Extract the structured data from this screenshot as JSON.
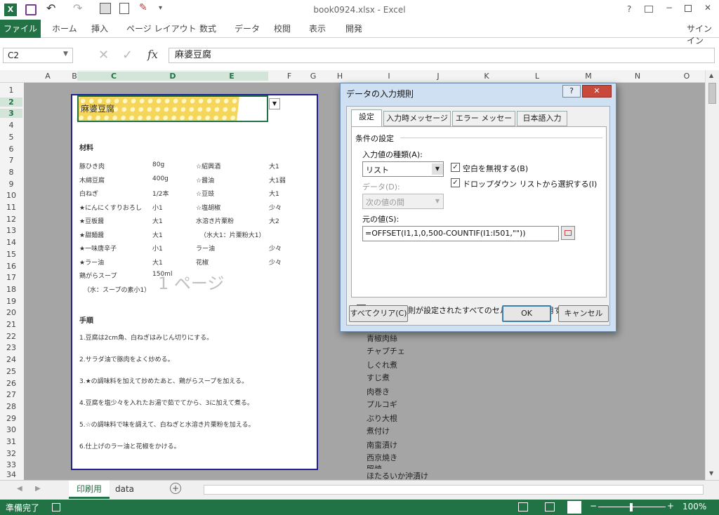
{
  "titlebar": {
    "title": "book0924.xlsx - Excel",
    "help": "?",
    "signin": "サインイン"
  },
  "ribbon": {
    "file": "ファイル",
    "tabs": [
      "ホーム",
      "挿入",
      "ページ レイアウト",
      "数式",
      "データ",
      "校閲",
      "表示",
      "開発"
    ]
  },
  "formula": {
    "namebox": "C2",
    "value": "麻婆豆腐",
    "fx": "fx"
  },
  "columns": [
    "A",
    "B",
    "C",
    "D",
    "E",
    "F",
    "G",
    "H",
    "I",
    "J",
    "K",
    "L",
    "M",
    "N",
    "O"
  ],
  "rows": [
    "1",
    "2",
    "3",
    "4",
    "5",
    "6",
    "7",
    "8",
    "9",
    "10",
    "11",
    "12",
    "13",
    "14",
    "15",
    "16",
    "17",
    "18",
    "19",
    "20",
    "21",
    "22",
    "23",
    "24",
    "25",
    "26",
    "27",
    "28",
    "29",
    "30",
    "31",
    "32",
    "33",
    "34"
  ],
  "page": {
    "title": "麻婆豆腐",
    "watermark": "1 ページ",
    "materials_heading": "材料",
    "ingredients": [
      [
        "豚ひき肉",
        "80g",
        "☆紹興酒",
        "大1"
      ],
      [
        "木綿豆腐",
        "400g",
        "☆醤油",
        "大1弱"
      ],
      [
        "白ねぎ",
        "1/2本",
        "☆豆豉",
        "大1"
      ],
      [
        "★にんにくすりおろし",
        "小1",
        "☆塩胡椒",
        "少々"
      ],
      [
        "★豆板醤",
        "大1",
        "水溶き片栗粉",
        "大2"
      ],
      [
        "★甜麺醤",
        "大1",
        "（水大1：片栗粉大1）",
        ""
      ],
      [
        "★一味唐辛子",
        "小1",
        "ラー油",
        "少々"
      ],
      [
        "★ラー油",
        "大1",
        "花椒",
        "少々"
      ],
      [
        "鶏がらスープ",
        "150ml",
        "",
        ""
      ],
      [
        "（水：スープの素小1）",
        "",
        "",
        ""
      ]
    ],
    "steps_heading": "手順",
    "steps": [
      "1.豆腐は2cm角、白ねぎはみじん切りにする。",
      "2.サラダ油で豚肉をよく炒める。",
      "3.★の調味料を加えて炒めたあと、鶏がらスープを加える。",
      "4.豆腐を塩少々を入れたお湯で茹でてから、3に加えて煮る。",
      "5.☆の調味料で味を調えて、白ねぎと水溶き片栗粉を加える。",
      "6.仕上げのラー油と花椒をかける。"
    ]
  },
  "list_items": [
    "青椒肉絲",
    "チャプチェ",
    "しぐれ煮",
    "すじ煮",
    "肉巻き",
    "プルコギ",
    "ぶり大根",
    "煮付け",
    "南蛮漬け",
    "西京焼き",
    "照焼",
    "ほたるいか沖漬け"
  ],
  "dialog": {
    "title": "データの入力規則",
    "tabs": [
      "設定",
      "入力時メッセージ",
      "エラー メッセージ",
      "日本語入力"
    ],
    "section": "条件の設定",
    "type_label": "入力値の種類(A):",
    "type_value": "リスト",
    "ignore_blank": "空白を無視する(B)",
    "dropdown": "ドロップダウン リストから選択する(I)",
    "data_label": "データ(D):",
    "data_value": "次の値の間",
    "source_label": "元の値(S):",
    "source_value": "=OFFSET(I1,1,0,500-COUNTIF(I1:I501,\"\"))",
    "apply_all": "同じ入力規則が設定されたすべてのセルに変更を適用する(P)",
    "clear_all": "すべてクリア(C)",
    "ok": "OK",
    "cancel": "キャンセル"
  },
  "sheets": [
    "印刷用",
    "data"
  ],
  "status": {
    "ready": "準備完了",
    "zoom": "100%"
  },
  "colors": {
    "excel_green": "#217346",
    "page_border": "#1f1f8f",
    "title_fill": "#f6d65a"
  }
}
